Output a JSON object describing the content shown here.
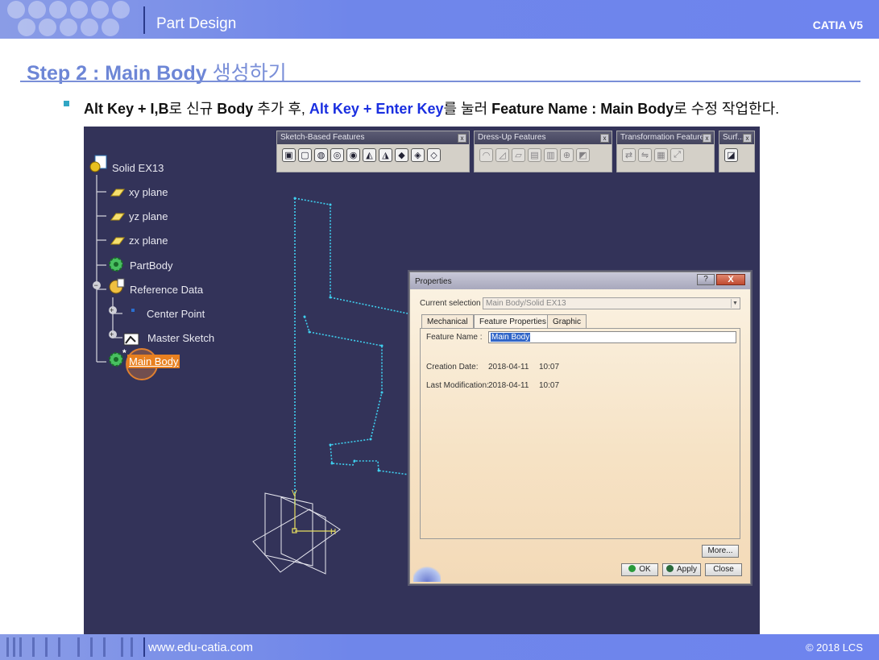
{
  "header": {
    "title": "Part Design",
    "brand": "CATIA V5"
  },
  "step": {
    "title_en": "Step 2 : Main Body",
    "title_kr": "생성하기"
  },
  "instruction": {
    "p1": "Alt Key + I,B",
    "p2": "로 신규 ",
    "p3": "Body",
    "p4": " 추가 후, ",
    "p5": "Alt Key + Enter Key",
    "p6": "를 눌러 ",
    "p7": "Feature Name : Main Body",
    "p8": "로 수정 작업한다."
  },
  "tree": {
    "root": "Solid EX13",
    "items": [
      "xy plane",
      "yz plane",
      "zx plane",
      "PartBody",
      "Reference Data",
      "Center Point",
      "Master Sketch",
      "Main Body"
    ]
  },
  "toolbars": [
    {
      "title": "Sketch-Based Features"
    },
    {
      "title": "Dress-Up Features"
    },
    {
      "title": "Transformation Features"
    },
    {
      "title": "Surf..."
    }
  ],
  "dialog": {
    "title": "Properties",
    "help": "?",
    "close": "X",
    "current_selection_label": "Current selection :",
    "current_selection_value": "Main Body/Solid EX13",
    "tabs": [
      "Mechanical",
      "Feature Properties",
      "Graphic"
    ],
    "feature_name_label": "Feature Name :",
    "feature_name_value": "Main Body",
    "creation_date_label": "Creation Date:",
    "creation_date_value": "2018-04-11",
    "creation_time": "10:07",
    "last_mod_label": "Last Modification:",
    "last_mod_value": "2018-04-11",
    "last_mod_time": "10:07",
    "more_label": "More...",
    "ok_label": "OK",
    "apply_label": "Apply",
    "close_label": "Close"
  },
  "footer": {
    "url": "www.edu-catia.com",
    "copyright": "© 2018 LCS"
  }
}
